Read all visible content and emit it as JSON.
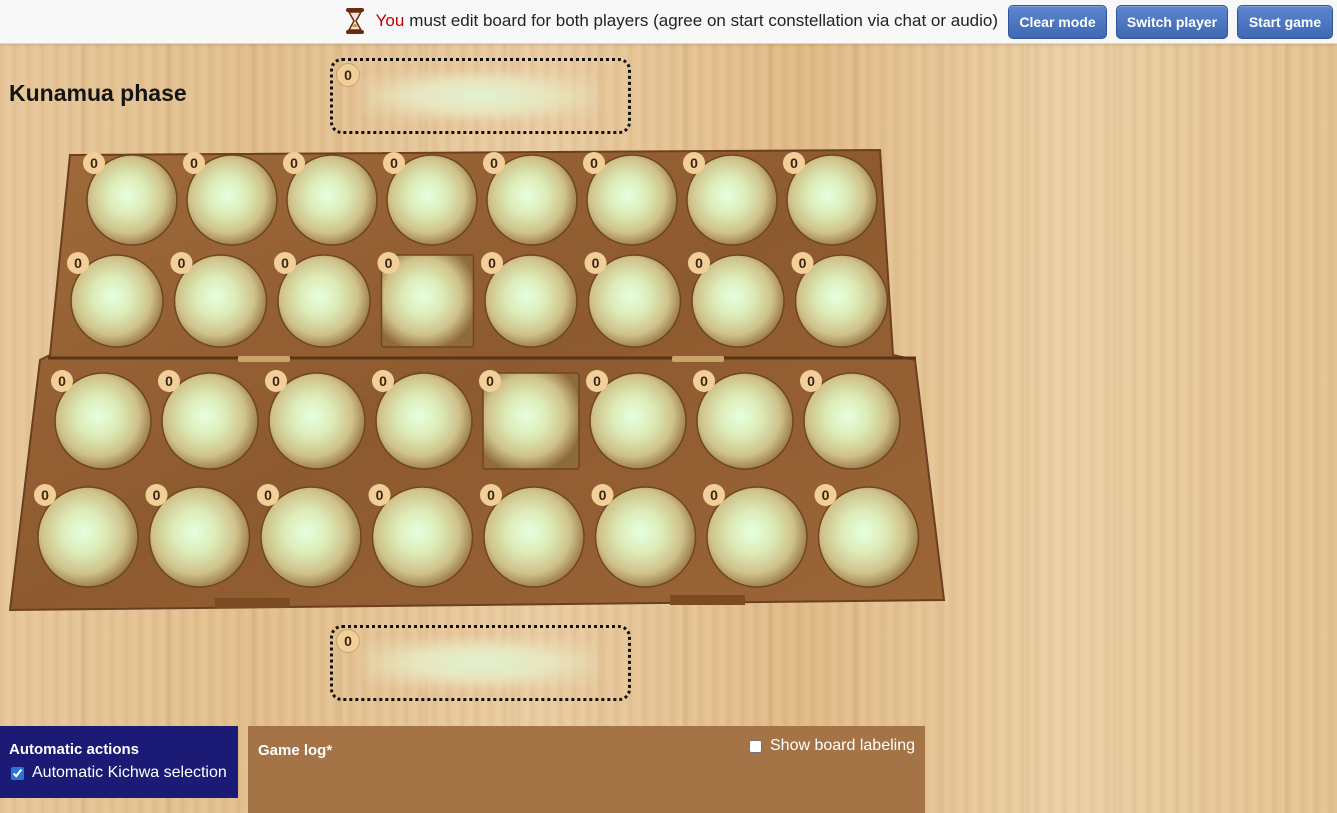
{
  "status": {
    "you": "You",
    "message": "must edit board for both players (agree on start constellation via chat or audio)"
  },
  "buttons": {
    "clear_mode": "Clear mode",
    "switch_player": "Switch player",
    "start_game": "Start game"
  },
  "phase_title": "Kunamua phase",
  "stores": {
    "top_count": "0",
    "bottom_count": "0"
  },
  "board": {
    "rows": [
      [
        "0",
        "0",
        "0",
        "0",
        "0",
        "0",
        "0",
        "0"
      ],
      [
        "0",
        "0",
        "0",
        "0",
        "0",
        "0",
        "0",
        "0"
      ],
      [
        "0",
        "0",
        "0",
        "0",
        "0",
        "0",
        "0",
        "0"
      ],
      [
        "0",
        "0",
        "0",
        "0",
        "0",
        "0",
        "0",
        "0"
      ]
    ],
    "square_pits": [
      [
        1,
        3
      ],
      [
        2,
        4
      ]
    ]
  },
  "automatic_actions": {
    "title": "Automatic actions",
    "kichwa_label": "Automatic Kichwa selection",
    "kichwa_checked": true
  },
  "game_log": {
    "title": "Game log*",
    "show_labeling_label": "Show board labeling",
    "show_labeling_checked": false
  },
  "colors": {
    "button_blue": "#4a75c2",
    "you_red": "#c30000",
    "auto_panel": "#1b1a75",
    "log_panel": "#a47447",
    "badge": "#f2cf98",
    "board_wood": "#9a6637"
  },
  "icons": {
    "status_icon": "hourglass-icon"
  }
}
